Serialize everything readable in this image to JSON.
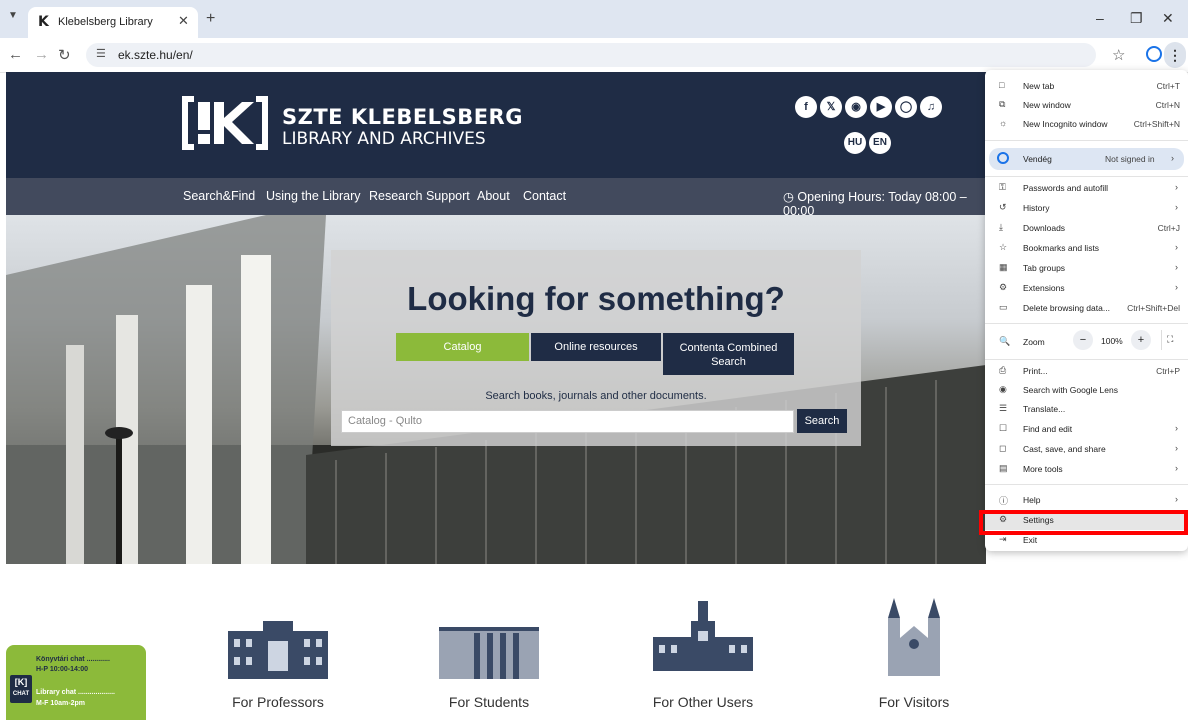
{
  "browser": {
    "tab_title": "Klebelsberg Library",
    "url": "ek.szte.hu/en/",
    "icons": {
      "back": "arrow-left",
      "forward": "arrow-right",
      "reload": "reload",
      "tune": "site-info",
      "star": "bookmark-star",
      "profile": "profile",
      "menu": "kebab-menu"
    }
  },
  "site": {
    "logo_line1": "SZTE KLEBELSBERG",
    "logo_line2": "LIBRARY AND ARCHIVES",
    "social": [
      "f",
      "X",
      "rss",
      "yt",
      "ig",
      "tt"
    ],
    "languages": [
      "HU",
      "EN"
    ],
    "nav": [
      "Search&Find",
      "Using the Library",
      "Research Support",
      "About",
      "Contact"
    ],
    "hours": "Opening Hours:  Today 08:00 – 00:00"
  },
  "hero": {
    "heading": "Looking for something?",
    "tabs": [
      "Catalog",
      "Online resources",
      "Contenta Combined Search"
    ],
    "hint": "Search books, journals and other documents.",
    "placeholder": "Catalog - Qulto",
    "search_label": "Search"
  },
  "categories": [
    "For Professors",
    "For Students",
    "For Other Users",
    "For Visitors"
  ],
  "chat": {
    "line1": "Könyvtári chat ............",
    "line2": "H-P 10:00-14:00",
    "line3": "Library chat ...................",
    "line4": "M-F 10am-2pm",
    "badge1": "[K]",
    "badge2": "CHAT"
  },
  "menu": {
    "items": [
      {
        "label": "New tab",
        "shortcut": "Ctrl+T",
        "icon": "new-tab-icon"
      },
      {
        "label": "New window",
        "shortcut": "Ctrl+N",
        "icon": "new-window-icon"
      },
      {
        "label": "New Incognito window",
        "shortcut": "Ctrl+Shift+N",
        "icon": "incognito-icon"
      }
    ],
    "profile_name": "Vendég",
    "profile_status": "Not signed in",
    "items2": [
      {
        "label": "Passwords and autofill",
        "shortcut": "",
        "arrow": true,
        "icon": "key-icon"
      },
      {
        "label": "History",
        "shortcut": "",
        "arrow": true,
        "icon": "history-icon"
      },
      {
        "label": "Downloads",
        "shortcut": "Ctrl+J",
        "arrow": false,
        "icon": "download-icon"
      },
      {
        "label": "Bookmarks and lists",
        "shortcut": "",
        "arrow": true,
        "icon": "star-icon"
      },
      {
        "label": "Tab groups",
        "shortcut": "",
        "arrow": true,
        "icon": "tab-groups-icon"
      },
      {
        "label": "Extensions",
        "shortcut": "",
        "arrow": true,
        "icon": "puzzle-icon"
      },
      {
        "label": "Delete browsing data...",
        "shortcut": "Ctrl+Shift+Del",
        "arrow": false,
        "icon": "trash-icon"
      }
    ],
    "zoom_label": "Zoom",
    "zoom_value": "100%",
    "items3": [
      {
        "label": "Print...",
        "shortcut": "Ctrl+P",
        "arrow": false,
        "icon": "print-icon"
      },
      {
        "label": "Search with Google Lens",
        "shortcut": "",
        "arrow": false,
        "icon": "lens-icon"
      },
      {
        "label": "Translate...",
        "shortcut": "",
        "arrow": false,
        "icon": "translate-icon"
      },
      {
        "label": "Find and edit",
        "shortcut": "",
        "arrow": true,
        "icon": "find-icon"
      },
      {
        "label": "Cast, save, and share",
        "shortcut": "",
        "arrow": true,
        "icon": "cast-icon"
      },
      {
        "label": "More tools",
        "shortcut": "",
        "arrow": true,
        "icon": "toolbox-icon"
      }
    ],
    "items4": [
      {
        "label": "Help",
        "shortcut": "",
        "arrow": true,
        "icon": "help-icon"
      },
      {
        "label": "Settings",
        "shortcut": "",
        "arrow": false,
        "icon": "gear-icon"
      },
      {
        "label": "Exit",
        "shortcut": "",
        "arrow": false,
        "icon": "exit-icon"
      }
    ]
  },
  "colors": {
    "brand_navy": "#1f2c45",
    "accent_green": "#8cba3a",
    "highlight": "#ff0000"
  }
}
